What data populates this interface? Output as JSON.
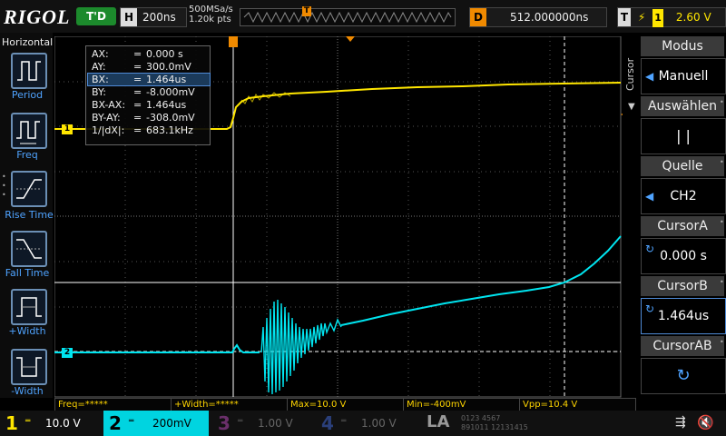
{
  "topbar": {
    "logo": "RIGOL",
    "trigger_status": "T'D",
    "horizontal_key": "H",
    "timebase": "200ns",
    "sample_rate": "500MSa/s",
    "points": "1.20k pts",
    "delay_key": "D",
    "delay": "512.000000ns",
    "trigger_key": "T",
    "trigger_source": "1",
    "trigger_level": "2.60 V"
  },
  "left_panel": {
    "title": "Horizontal",
    "items": [
      {
        "label": "Period",
        "icon": "period-icon"
      },
      {
        "label": "Freq",
        "icon": "freq-icon"
      },
      {
        "label": "Rise Time",
        "icon": "rise-time-icon"
      },
      {
        "label": "Fall Time",
        "icon": "fall-time-icon"
      },
      {
        "label": "+Width",
        "icon": "positive-width-icon"
      },
      {
        "label": "-Width",
        "icon": "negative-width-icon"
      }
    ]
  },
  "right_panel": {
    "vertical_label": "Cursor",
    "mode_label": "Modus",
    "mode_value": "Manuell",
    "select_label": "Auswählen",
    "select_value": "| |",
    "source_label": "Quelle",
    "source_value": "CH2",
    "cursor_a_label": "CursorA",
    "cursor_a_value": "0.000 s",
    "cursor_b_label": "CursorB",
    "cursor_b_value": "1.464us",
    "cursor_ab_label": "CursorAB"
  },
  "cursor_info": [
    {
      "key": "AX:",
      "value": "0.000 s"
    },
    {
      "key": "AY:",
      "value": "300.0mV"
    },
    {
      "key": "BX:",
      "value": "1.464us"
    },
    {
      "key": "BY:",
      "value": "-8.000mV"
    },
    {
      "key": "BX-AX:",
      "value": "1.464us"
    },
    {
      "key": "BY-AY:",
      "value": "-308.0mV"
    },
    {
      "key": "1/|dX|:",
      "value": "683.1kHz"
    }
  ],
  "measurements": [
    {
      "label": "Freq=*****"
    },
    {
      "label": "+Width=*****"
    },
    {
      "label": "Max=10.0 V"
    },
    {
      "label": "Min=-400mV"
    },
    {
      "label": "Vpp=10.4 V"
    }
  ],
  "channels": [
    {
      "num": "1",
      "scale": "10.0 V",
      "color": "#ffe600"
    },
    {
      "num": "2",
      "scale": "200mV",
      "color": "#00e5f0"
    },
    {
      "num": "3",
      "scale": "1.00 V",
      "color": "#d24fd2"
    },
    {
      "num": "4",
      "scale": "1.00 V",
      "color": "#3a7bff"
    }
  ],
  "la_label": "LA",
  "la_digits": [
    "0",
    "1",
    "2",
    "3",
    "4",
    "5",
    "6",
    "7",
    "8",
    "9",
    "10",
    "11",
    "12",
    "13",
    "14",
    "15"
  ],
  "markers": {
    "ch1": "1",
    "ch2": "2",
    "trigger_pos": "T"
  },
  "colors": {
    "ch1": "#ffe600",
    "ch2": "#00e5f0",
    "accent_blue": "#4fa3ff",
    "trigger": "#f08a00"
  }
}
